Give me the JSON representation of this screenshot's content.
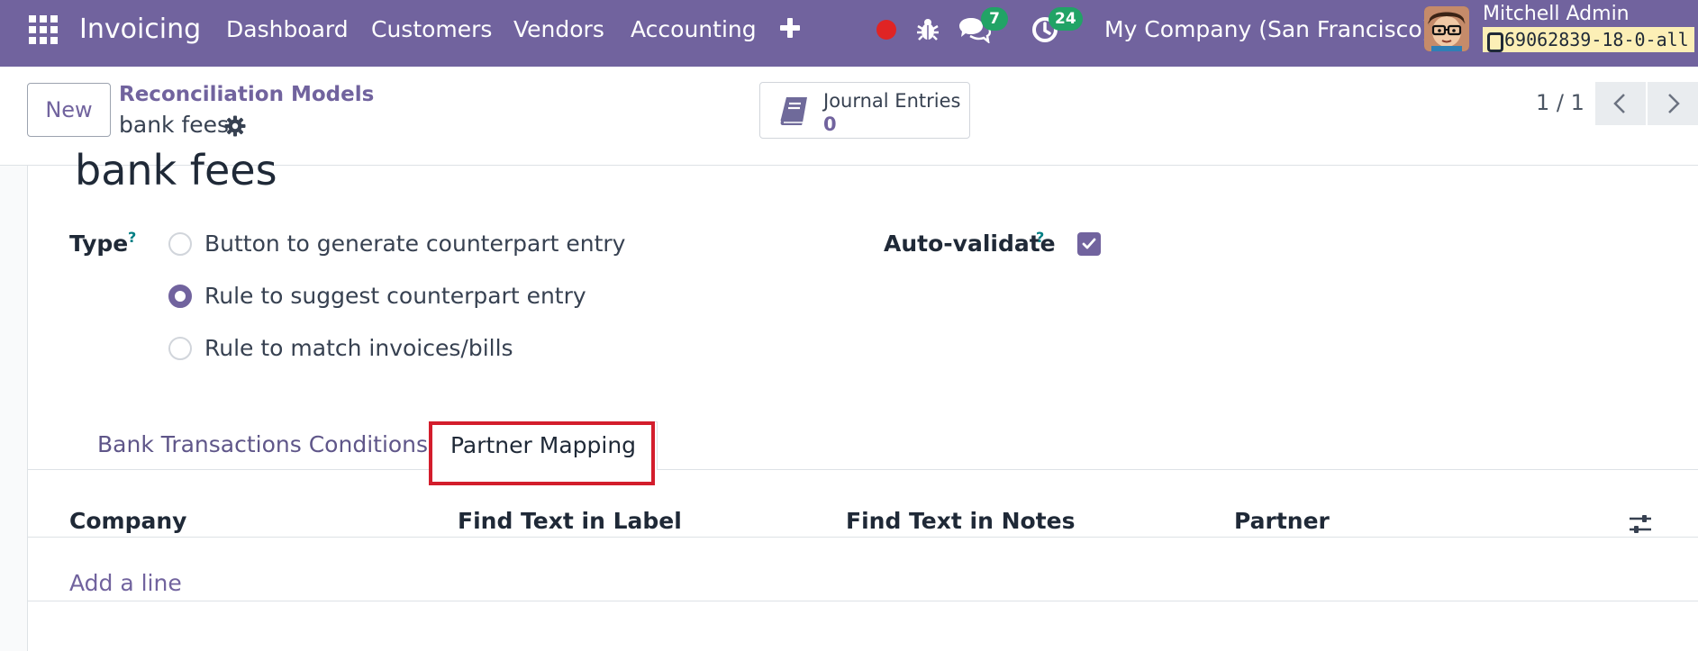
{
  "navbar": {
    "app_name": "Invoicing",
    "menu": [
      "Dashboard",
      "Customers",
      "Vendors",
      "Accounting"
    ],
    "messages_count": "7",
    "activities_count": "24",
    "company": "My Company (San Francisco)",
    "user_name": "Mitchell Admin",
    "database": "69062839-18-0-all",
    "colors": {
      "brand": "#71639e",
      "badge": "#21a366",
      "record": "#e02424"
    }
  },
  "control_panel": {
    "new_label": "New",
    "breadcrumb_parent": "Reconciliation Models",
    "breadcrumb_current": "bank fees",
    "smart_button": {
      "label": "Journal Entries",
      "value": "0"
    },
    "pager": "1 / 1"
  },
  "form": {
    "title": "bank fees",
    "type_label": "Type",
    "type_help": "?",
    "type_options": [
      {
        "label": "Button to generate counterpart entry",
        "selected": false
      },
      {
        "label": "Rule to suggest counterpart entry",
        "selected": true
      },
      {
        "label": "Rule to match invoices/bills",
        "selected": false
      }
    ],
    "auto_validate_label": "Auto-validate",
    "auto_validate_help": "?",
    "auto_validate_checked": true
  },
  "tabs": {
    "items": [
      "Bank Transactions Conditions",
      "Partner Mapping"
    ],
    "active": "Partner Mapping"
  },
  "table": {
    "columns": [
      "Company",
      "Find Text in Label",
      "Find Text in Notes",
      "Partner"
    ],
    "add_line": "Add a line"
  }
}
